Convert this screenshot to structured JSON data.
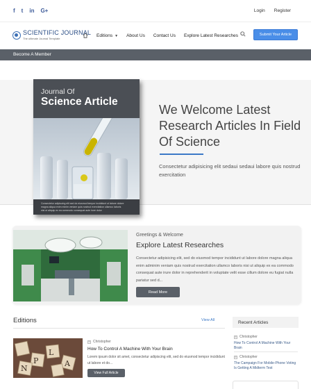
{
  "topbar": {
    "social": [
      {
        "icon": "facebook-icon",
        "glyph": "f"
      },
      {
        "icon": "twitter-icon",
        "glyph": "t"
      },
      {
        "icon": "linkedin-icon",
        "glyph": "in"
      },
      {
        "icon": "google-plus-icon",
        "glyph": "G+"
      }
    ],
    "login": "Login",
    "register": "Register"
  },
  "nav": {
    "logo_title": "SCIENTIFIC JOURNAL",
    "logo_sub": "The ultimate Journal Template",
    "editions": "Editions",
    "about": "About Us",
    "contact": "Contact Us",
    "explore": "Explore Latest Researches",
    "submit": "Submit Your Article"
  },
  "strip": {
    "become_member": "Become A Member"
  },
  "hero": {
    "book_kicker": "Journal Of",
    "book_title": "Science Article",
    "book_blurb_1": "Consectetur adipiscing elit sed do eiusmod tempor incididunt ut labore dolore",
    "book_blurb_2": "magna aliqua enim minim veniam quis nostrud exercitation ullamco laboris",
    "book_blurb_3": "nisi ut aliquip ex ea commodo consequat aute irure dolor",
    "title": "We Welcome Latest Research Articles In Field Of Science",
    "subtitle": "Consectetur adipisicing elit sedaui sedaui labore quis nostrud exercitation"
  },
  "greeting": {
    "kicker": "Greetings & Welcome",
    "title": "Explore Latest Researches",
    "body": "Consectetur adipisicing elit, sed do eiusmod tempor incididunt ut labore dolore magna aliqua enim adminim veniam quis nostrud exercitation ullamco laboris nisi ut aliquip ex ea commodo consequat aute irure dolor in reprehenderit in voluptate velit esse cillum dolore eu fugiat nulla pariatur sed d...",
    "read_more": "Read More"
  },
  "editions": {
    "title": "Editions",
    "view_all": "View All",
    "author": "Christopher",
    "article_title": "How To Control A Machine With Your Brain",
    "body": "Lorem ipsum dolor sit amet, consectetur adipiscing elit, sed do eiusmod tempor incididunt ut labore et do...",
    "button": "View Full Article"
  },
  "recent": {
    "title": "Recent Articles",
    "items": [
      {
        "author": "Christopher",
        "title": "How To Control A Machine With Your Brain"
      },
      {
        "author": "Christopher",
        "title": "The Campaign For Mobile-Phone Voting Is Getting A Midterm Test"
      }
    ]
  },
  "colors": {
    "accent": "#4a8ee8",
    "dark": "#5a6068",
    "link": "#3b78c6"
  }
}
